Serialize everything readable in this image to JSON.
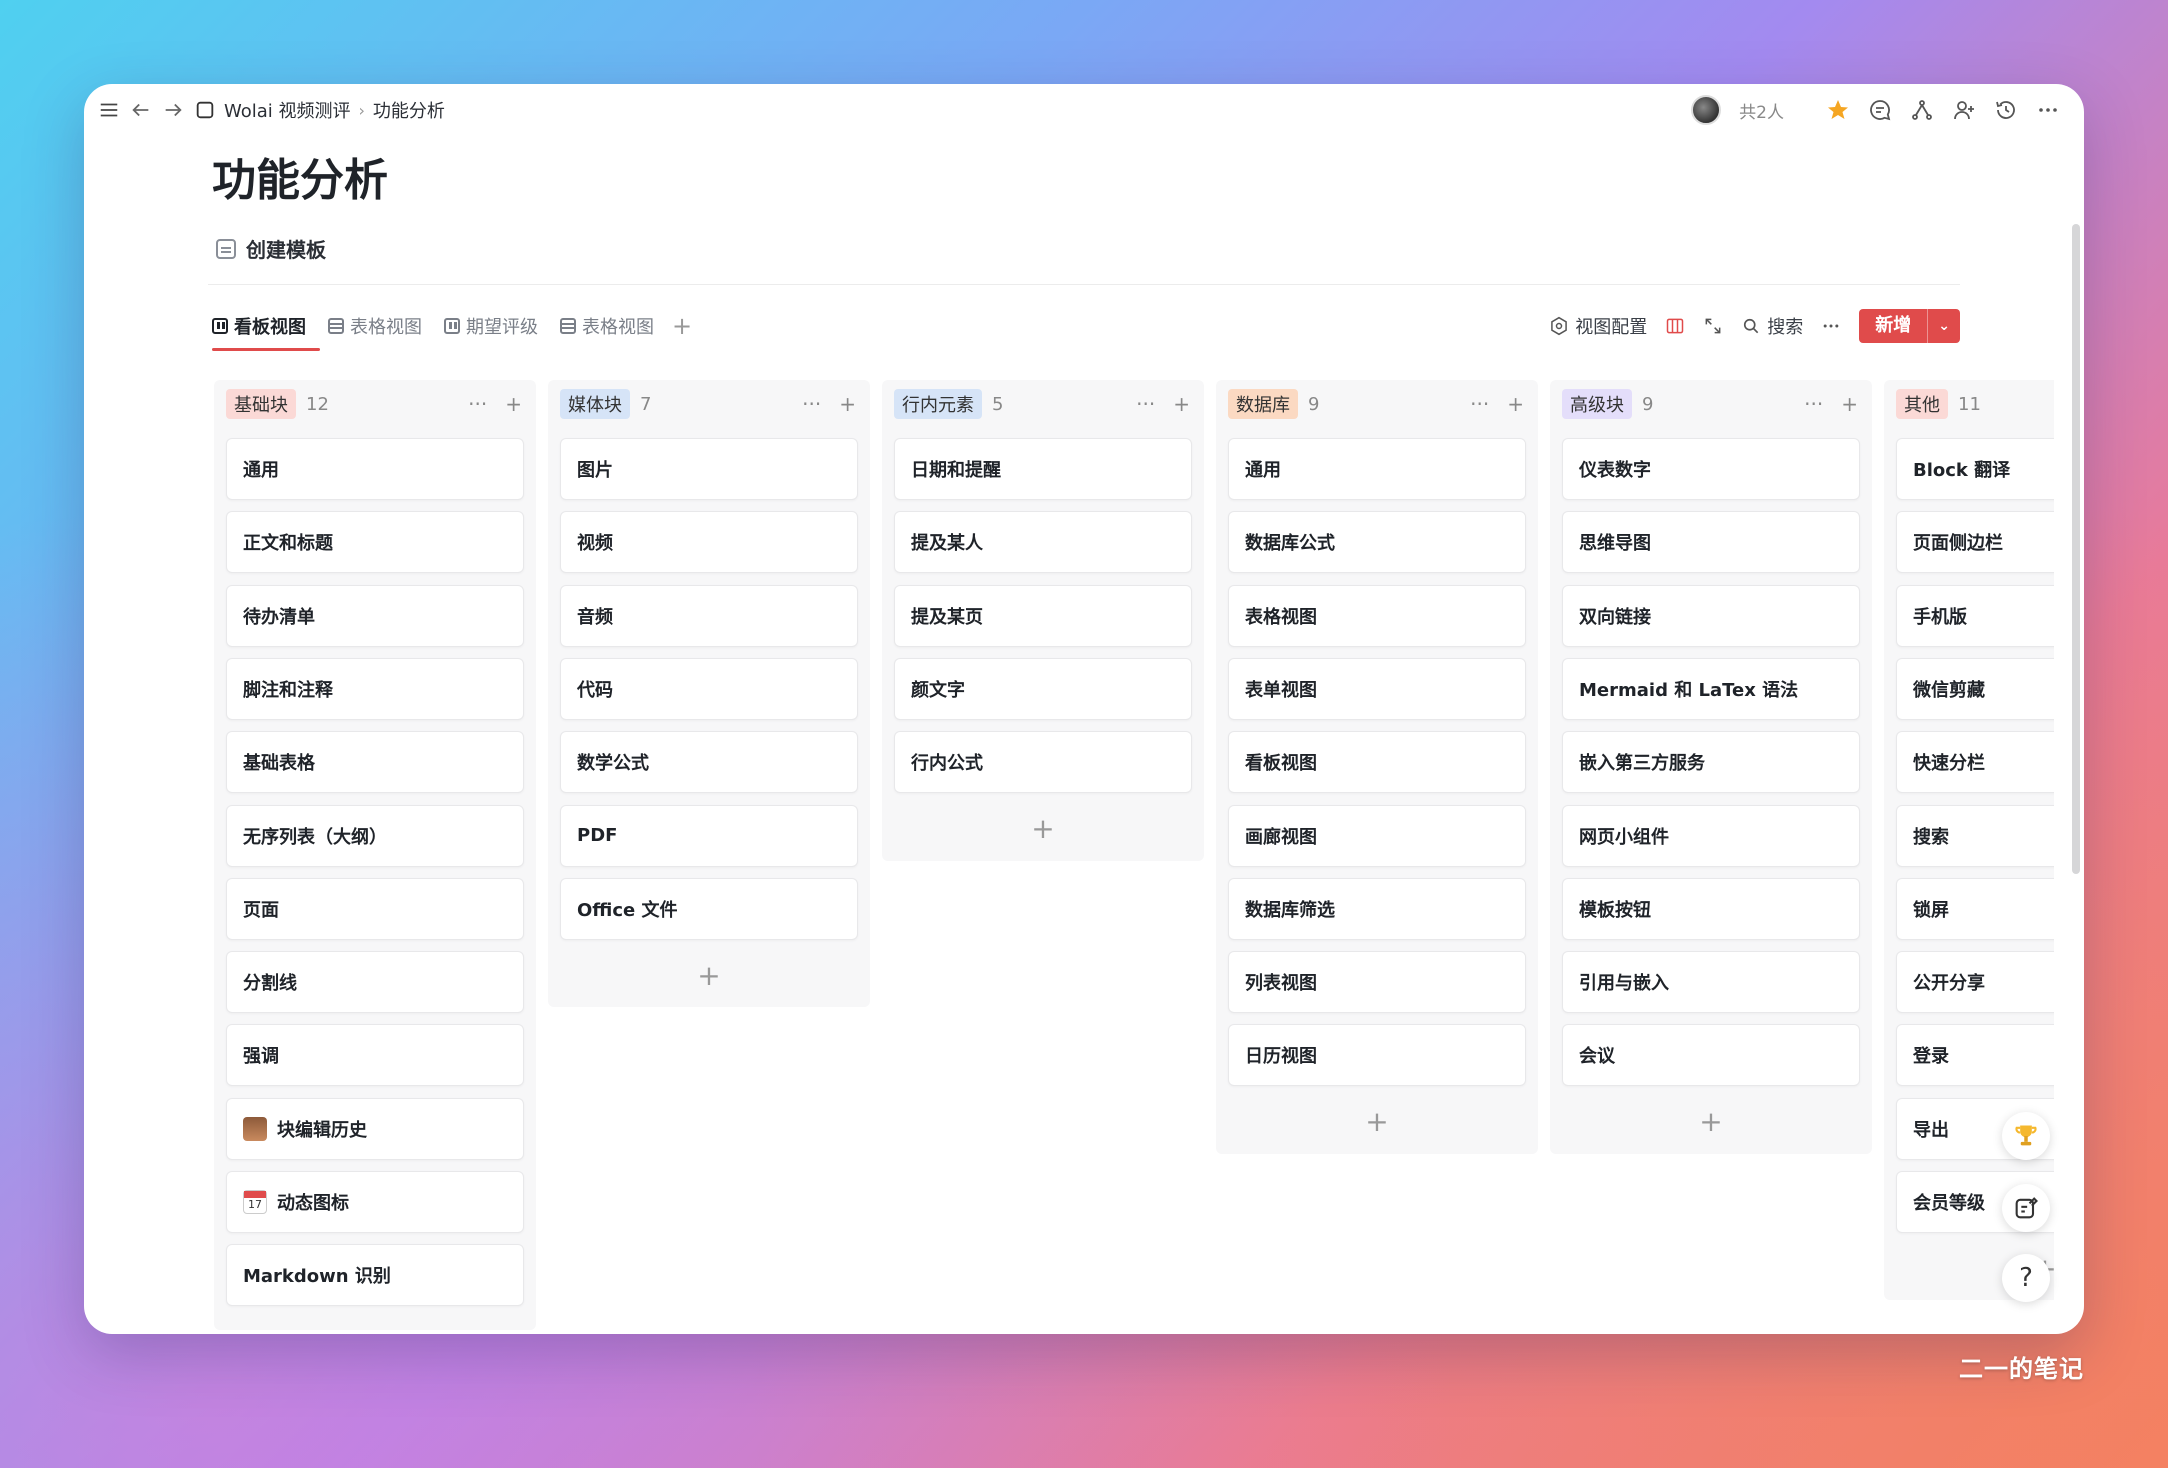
{
  "breadcrumb": {
    "workspace": "Wolai 视频测评",
    "page": "功能分析"
  },
  "topbar": {
    "members": "共2人"
  },
  "page": {
    "title": "功能分析",
    "template_label": "创建模板"
  },
  "views": {
    "tabs": [
      {
        "label": "看板视图",
        "icon": "board-icon",
        "active": true
      },
      {
        "label": "表格视图",
        "icon": "table-icon",
        "active": false
      },
      {
        "label": "期望评级",
        "icon": "board-icon",
        "active": false
      },
      {
        "label": "表格视图",
        "icon": "table-icon",
        "active": false
      }
    ],
    "add": "+",
    "config": "视图配置",
    "search": "搜索",
    "new_button": "新增"
  },
  "colors": {
    "accent": "#e04b4b",
    "tag_basic": "#fbd9d6",
    "tag_media": "#d6e4f7",
    "tag_inline": "#d6e4f7",
    "tag_db": "#fbd9c2",
    "tag_advanced": "#e4defa",
    "tag_other": "#fbd9d6"
  },
  "board": {
    "columns": [
      {
        "tag": "基础块",
        "count": "12",
        "cards": [
          "通用",
          "正文和标题",
          "待办清单",
          "脚注和注释",
          "基础表格",
          "无序列表（大纲）",
          "页面",
          "分割线",
          "强调",
          "块编辑历史",
          "动态图标",
          "Markdown 识别"
        ]
      },
      {
        "tag": "媒体块",
        "count": "7",
        "cards": [
          "图片",
          "视频",
          "音频",
          "代码",
          "数学公式",
          "PDF",
          "Office 文件"
        ]
      },
      {
        "tag": "行内元素",
        "count": "5",
        "cards": [
          "日期和提醒",
          "提及某人",
          "提及某页",
          "颜文字",
          "行内公式"
        ]
      },
      {
        "tag": "数据库",
        "count": "9",
        "cards": [
          "通用",
          "数据库公式",
          "表格视图",
          "表单视图",
          "看板视图",
          "画廊视图",
          "数据库筛选",
          "列表视图",
          "日历视图"
        ]
      },
      {
        "tag": "高级块",
        "count": "9",
        "cards": [
          "仪表数字",
          "思维导图",
          "双向链接",
          "Mermaid 和 LaTex 语法",
          "嵌入第三方服务",
          "网页小组件",
          "模板按钮",
          "引用与嵌入",
          "会议"
        ]
      },
      {
        "tag": "其他",
        "count": "11",
        "cards": [
          "Block 翻译",
          "页面侧边栏",
          "手机版",
          "微信剪藏",
          "快速分栏",
          "搜索",
          "锁屏",
          "公开分享",
          "登录",
          "导出",
          "会员等级"
        ]
      }
    ]
  },
  "help": "?",
  "watermark": "二一的笔记"
}
